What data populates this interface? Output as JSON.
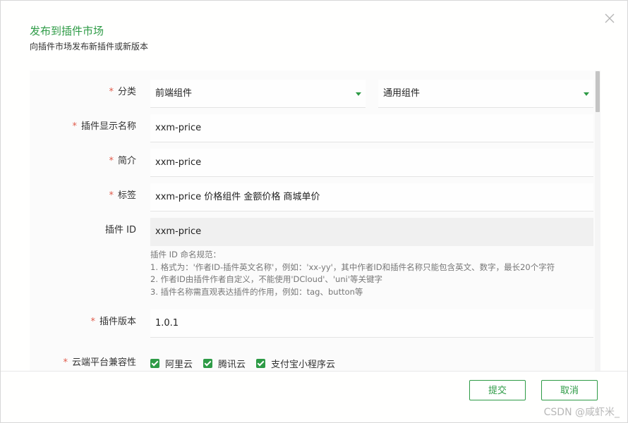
{
  "dialog": {
    "title": "发布到插件市场",
    "subtitle": "向插件市场发布新插件或新版本"
  },
  "form": {
    "category": {
      "label": "分类",
      "required_mark": "*",
      "primary_value": "前端组件",
      "secondary_value": "通用组件"
    },
    "display_name": {
      "label": "插件显示名称",
      "required_mark": "*",
      "value": "xxm-price"
    },
    "summary": {
      "label": "简介",
      "required_mark": "*",
      "value": "xxm-price"
    },
    "tags": {
      "label": "标签",
      "required_mark": "*",
      "value": "xxm-price 价格组件 金额价格 商城单价"
    },
    "plugin_id": {
      "label": "插件 ID",
      "value": "xxm-price",
      "help": [
        "插件 ID 命名规范：",
        "1. 格式为：'作者ID-插件英文名称'，例如：'xx-yy'，其中作者ID和插件名称只能包含英文、数字，最长20个字符",
        "2. 作者ID由插件作者自定义，不能使用'DCloud'、'uni'等关键字",
        "3. 插件名称需直观表达插件的作用，例如：tag、button等"
      ]
    },
    "version": {
      "label": "插件版本",
      "required_mark": "*",
      "value": "1.0.1"
    },
    "cloud_compat": {
      "label": "云端平台兼容性",
      "required_mark": "*",
      "options": [
        {
          "label": "阿里云",
          "checked": true
        },
        {
          "label": "腾讯云",
          "checked": true
        },
        {
          "label": "支付宝小程序云",
          "checked": true
        }
      ]
    }
  },
  "footer": {
    "submit_label": "提交",
    "cancel_label": "取消"
  },
  "watermark": "CSDN @咸虾米_",
  "colors": {
    "accent": "#2e9b46",
    "required": "#e05a4a"
  },
  "icons": {
    "close": "close-icon",
    "select_caret": "chevron-down-icon",
    "checkbox": "checkmark-icon"
  }
}
